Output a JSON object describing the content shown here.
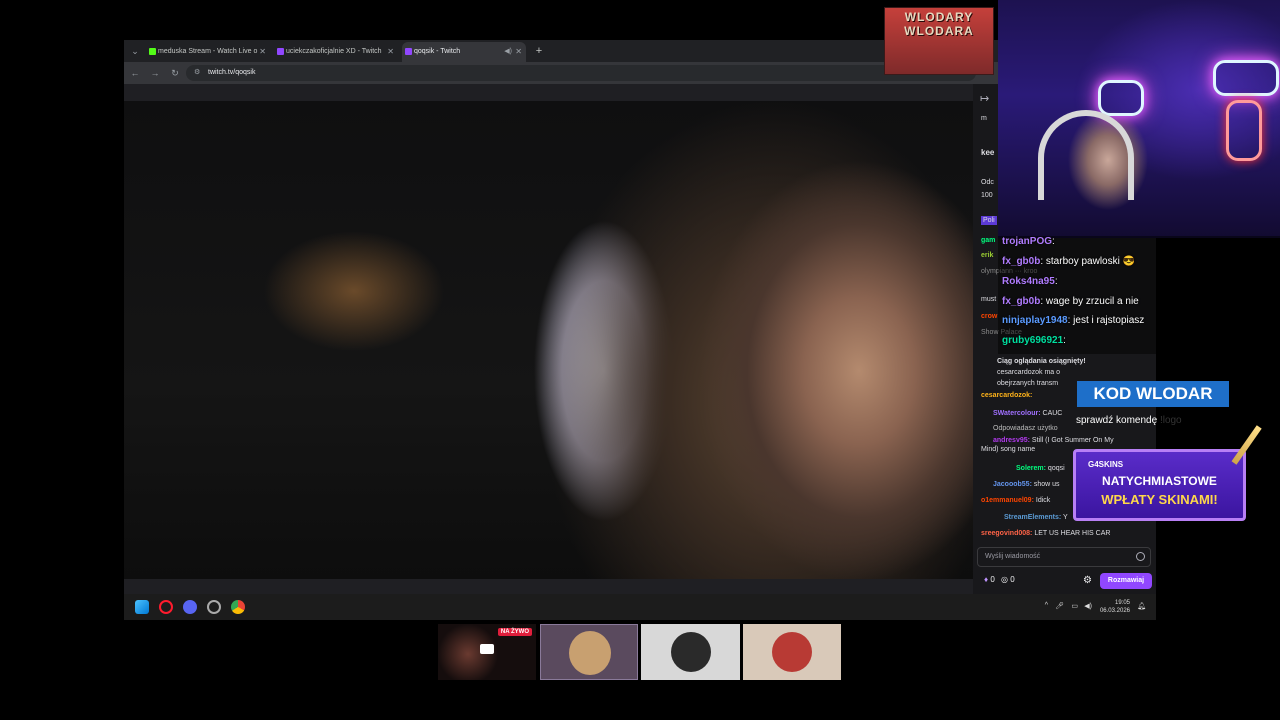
{
  "browser": {
    "tabs": [
      {
        "label": "meduska Stream - Watch Live o",
        "favicon_color": "#53fc18"
      },
      {
        "label": "uciekczakoficjalnie XD - Twitch",
        "favicon_color": "#9147ff"
      },
      {
        "label": "qoqsik - Twitch",
        "favicon_color": "#9147ff"
      }
    ],
    "new_tab": "+",
    "url": "twitch.tv/qoqsik"
  },
  "twitch_chat": {
    "top_lines": [
      "m",
      "kee",
      "Odc",
      "100",
      "Poli"
    ],
    "messages": [
      {
        "user": "gam",
        "text": "",
        "color": "#00ff7f"
      },
      {
        "user": "erik",
        "text": "",
        "color": "#9acd32"
      },
      {
        "user": "",
        "text": "olympiann ··· kroo",
        "color": "#ff69b4"
      },
      {
        "user": "",
        "text": "must",
        "color": "#ffffff"
      },
      {
        "user": "crow",
        "text": "",
        "color": "#ff4500"
      },
      {
        "user": "",
        "text": "Show Palace",
        "color": "#8a8a8a"
      },
      {
        "user": "",
        "text": "Ciąg oglądania osiągnięty!",
        "color": "#ffffff"
      },
      {
        "user": "",
        "text": "cesarcardozok ma o",
        "color": "#ffffff"
      },
      {
        "user": "",
        "text": "obejrzanych transm",
        "color": "#ffffff"
      },
      {
        "user": "cesarcardozok:",
        "text": "",
        "color": "#ffb31a"
      },
      {
        "user": "SWatercolour:",
        "text": "CAUC",
        "color": "#8a2be2"
      },
      {
        "user": "",
        "text": "Odpowiadasz użytko",
        "color": "#bbbbbb"
      },
      {
        "user": "andresv95:",
        "text": "Still (I Got Summer On My",
        "color": "#b23aee"
      },
      {
        "user": "",
        "text": "Mind) song name",
        "color": "#ffffff"
      },
      {
        "user": "Solerem:",
        "text": "qoqsi",
        "color": "#00ff7f"
      },
      {
        "user": "Jacooob55:",
        "text": "show us",
        "color": "#6495ed"
      },
      {
        "user": "o1emmanuel09:",
        "text": "Idick",
        "color": "#ff4500"
      },
      {
        "user": "StreamElements:",
        "text": "Y",
        "color": "#5b9bd5"
      },
      {
        "user": "sreegovind008:",
        "text": "LET US HEAR HIS CAR",
        "color": "#ff6347"
      }
    ],
    "input_placeholder": "Wyślij wiadomość",
    "points_a": "0",
    "points_b": "0",
    "chat_button": "Rozmawiaj"
  },
  "taskbar": {
    "time": "19:05",
    "date": "06.03.2026"
  },
  "overlay": {
    "badge_text": "WLODARY WLODARA",
    "chat": [
      {
        "user": "trojanPOG",
        "text": "",
        "color": "#b07cff"
      },
      {
        "user": "fx_gb0b",
        "text": "starboy pawloski 😎",
        "color": "#b07cff"
      },
      {
        "user": "Roks4na95",
        "text": "",
        "color": "#b07cff"
      },
      {
        "user": "fx_gb0b",
        "text": "wage by zrzucil a nie",
        "color": "#b07cff"
      },
      {
        "user": "ninjaplay1948",
        "text": "jest i rajstopiasz",
        "color": "#5b9bff"
      },
      {
        "user": "gruby696921",
        "text": "",
        "color": "#00e0a0"
      }
    ],
    "kod": "KOD WLODAR",
    "sprawdz": "sprawdź komendę",
    "sprawdz_cmd": "!logo",
    "skins_logo": "G4SKINS",
    "skins_line1": "NATYCHMIASTOWE",
    "skins_line2": "WPŁATY SKINAMI!"
  },
  "thumbnails": {
    "live_badge": "NA ŻYWO"
  }
}
